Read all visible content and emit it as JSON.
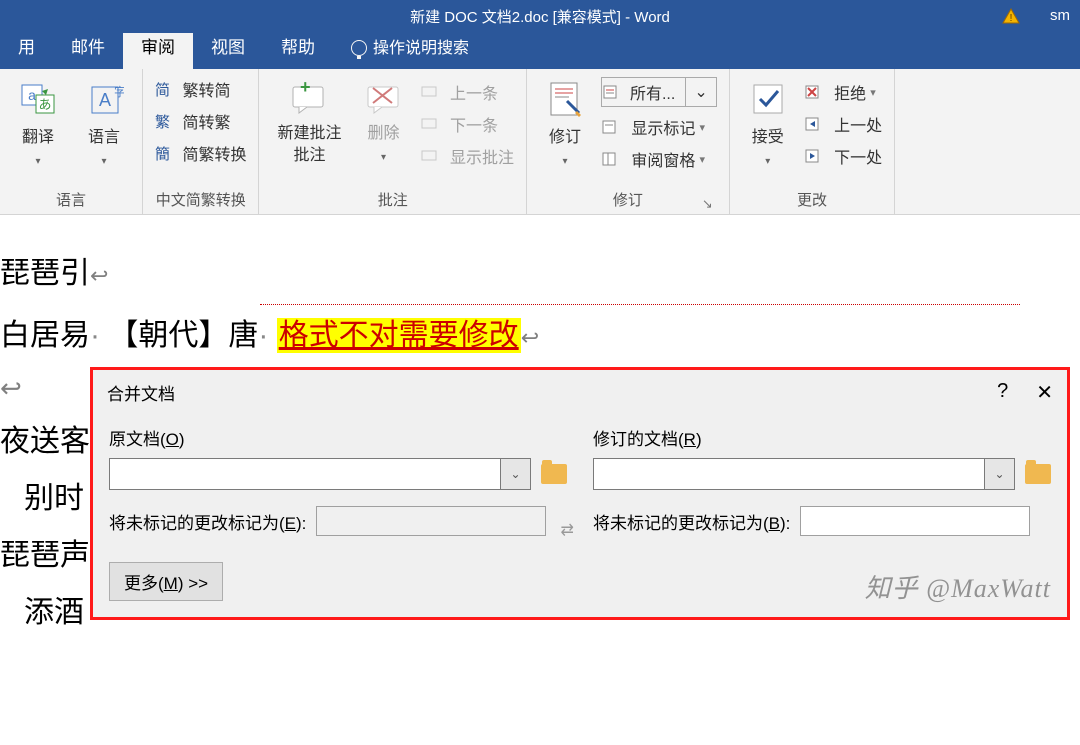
{
  "title": "新建 DOC 文档2.doc [兼容模式]  -  Word",
  "titleuser": "sm",
  "tabs": {
    "t0": "用",
    "t1": "邮件",
    "t2": "审阅",
    "t3": "视图",
    "t4": "帮助",
    "tellme": "操作说明搜索"
  },
  "ribbon": {
    "language": {
      "translate": "翻译",
      "lang": "语言",
      "group": "语言"
    },
    "convert": {
      "f2j": "繁转简",
      "j2f": "简转繁",
      "jfswap": "简繁转换",
      "group": "中文简繁转换"
    },
    "comments": {
      "new": "新建批注",
      "newl2": "批注",
      "del": "删除",
      "prev": "上一条",
      "next": "下一条",
      "show": "显示批注",
      "group": "批注"
    },
    "tracking": {
      "track": "修订",
      "allmarkup": "所有...",
      "showmark": "显示标记",
      "reviewpane": "审阅窗格",
      "group": "修订"
    },
    "changes": {
      "accept": "接受",
      "reject": "拒绝",
      "prev": "上一处",
      "next": "下一处",
      "group": "更改"
    }
  },
  "doc": {
    "line1": "琵琶引",
    "line2a": "白居易",
    "line2b": "【朝代】唐",
    "line2c": "格式不对需要修改",
    "line3a": "夜送客",
    "line3b": "别时",
    "line3c": "琵琶声",
    "line3d": "添酒"
  },
  "dialog": {
    "title": "合并文档",
    "orig_label_pre": "原文档(",
    "orig_key": "O",
    "orig_label_post": ")",
    "rev_label_pre": "修订的文档(",
    "rev_key": "R",
    "rev_label_post": ")",
    "mark_label_pre": "将未标记的更改标记为(",
    "mark_key1": "E",
    "mark_key2": "B",
    "mark_label_post": "):",
    "more_pre": "更多(",
    "more_key": "M",
    "more_post": ") >>",
    "help": "?",
    "close": "✕",
    "watermark": "知乎 @MaxWatt"
  }
}
